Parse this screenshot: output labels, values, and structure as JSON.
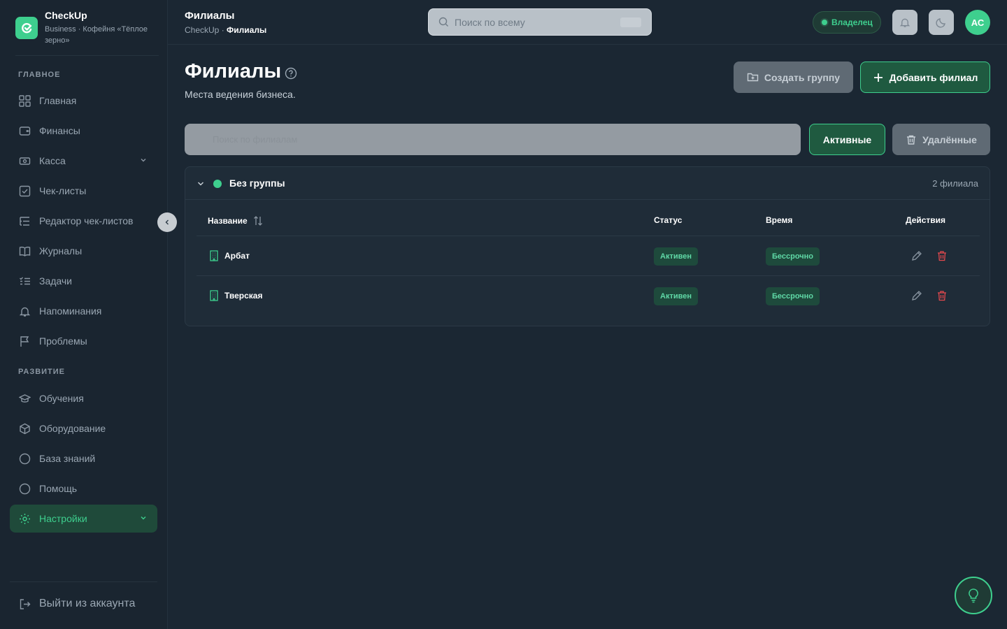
{
  "brand": {
    "name": "CheckUp",
    "subtitle": "Business · Кофейня «Тёплое зерно»"
  },
  "sidebar": {
    "section_main": "ГЛАВНОЕ",
    "section_dev": "РАЗВИТИЕ",
    "items": [
      {
        "label": "Главная",
        "icon": "dashboard-icon"
      },
      {
        "label": "Финансы",
        "icon": "wallet-icon"
      },
      {
        "label": "Касса",
        "icon": "cash-register-icon"
      },
      {
        "label": "Чек-листы",
        "icon": "checklist-icon"
      },
      {
        "label": "Редактор чек-листов",
        "icon": "list-editor-icon"
      },
      {
        "label": "Журналы",
        "icon": "book-icon"
      },
      {
        "label": "Задачи",
        "icon": "tasks-icon"
      },
      {
        "label": "Напоминания",
        "icon": "bell-icon"
      },
      {
        "label": "Проблемы",
        "icon": "flag-icon"
      },
      {
        "label": "Обучения",
        "icon": "graduation-cap-icon"
      },
      {
        "label": "Оборудование",
        "icon": "box-icon"
      },
      {
        "label": "База знаний",
        "icon": "circle-icon"
      },
      {
        "label": "Помощь",
        "icon": "circle-icon"
      },
      {
        "label": "Настройки",
        "icon": "gear-icon"
      }
    ],
    "logout": "Выйти из аккаунта"
  },
  "header": {
    "title": "Филиалы",
    "breadcrumb_root": "CheckUp",
    "breadcrumb_sep": " · ",
    "breadcrumb_current": "Филиалы",
    "search_placeholder": "Поиск по всему",
    "role": "Владелец",
    "avatar_initials": "АС"
  },
  "page": {
    "title": "Филиалы",
    "subtitle": "Места ведения бизнеса.",
    "create_group": "Создать группу",
    "add_branch": "Добавить филиал",
    "search_placeholder": "Поиск по филиалам",
    "filter_active": "Активные",
    "filter_deleted": "Удалённые"
  },
  "group": {
    "name": "Без группы",
    "count": "2 филиала",
    "columns": {
      "name": "Название",
      "status": "Статус",
      "time": "Время",
      "actions": "Действия"
    },
    "rows": [
      {
        "name": "Арбат",
        "status": "Активен",
        "time": "Бессрочно"
      },
      {
        "name": "Тверская",
        "status": "Активен",
        "time": "Бессрочно"
      }
    ]
  },
  "colors": {
    "accent": "#3ecf8e",
    "background": "#1b2733",
    "danger": "#e5484d"
  }
}
